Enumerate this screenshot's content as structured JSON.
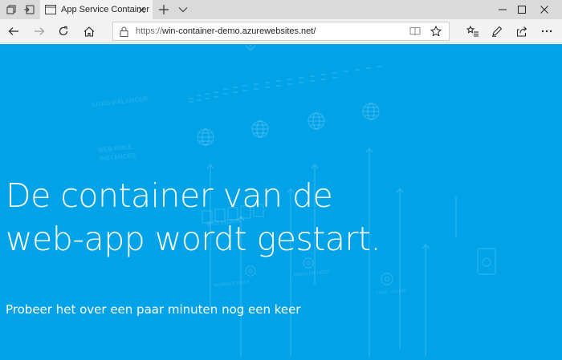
{
  "browser": {
    "tab": {
      "title": "App Service Container"
    },
    "address": {
      "scheme": "https://",
      "host_path": "win-container-demo.azurewebsites.net/"
    },
    "icons": {
      "tab_actions": "tabs-aside-icon",
      "set_aside": "set-aside-icon",
      "tab_close": "close-icon",
      "new_tab": "plus-icon",
      "tab_menu": "chevron-down-icon",
      "minimize": "minimize-icon",
      "maximize": "maximize-icon",
      "close": "close-icon",
      "back": "back-arrow-icon",
      "forward": "forward-arrow-icon",
      "refresh": "refresh-icon",
      "home": "home-icon",
      "lock": "lock-icon",
      "reading_view": "reading-view-icon",
      "favorite": "star-icon",
      "favorites_hub": "favorites-hub-icon",
      "notes": "pen-icon",
      "share": "share-icon",
      "more": "more-icon"
    }
  },
  "page": {
    "background_color": "#00a2e8",
    "headline": [
      "De container van de",
      "web-app wordt gestart."
    ],
    "subtext": "Probeer het over een paar minuten nog een keer",
    "watermark_labels": [
      "LOAD BALANCER",
      "WEB ROLE",
      "INSTANCES",
      "ESSAGING",
      "WORKER ROLE",
      "WORKER ROLE",
      "TYPE CACHE"
    ]
  }
}
